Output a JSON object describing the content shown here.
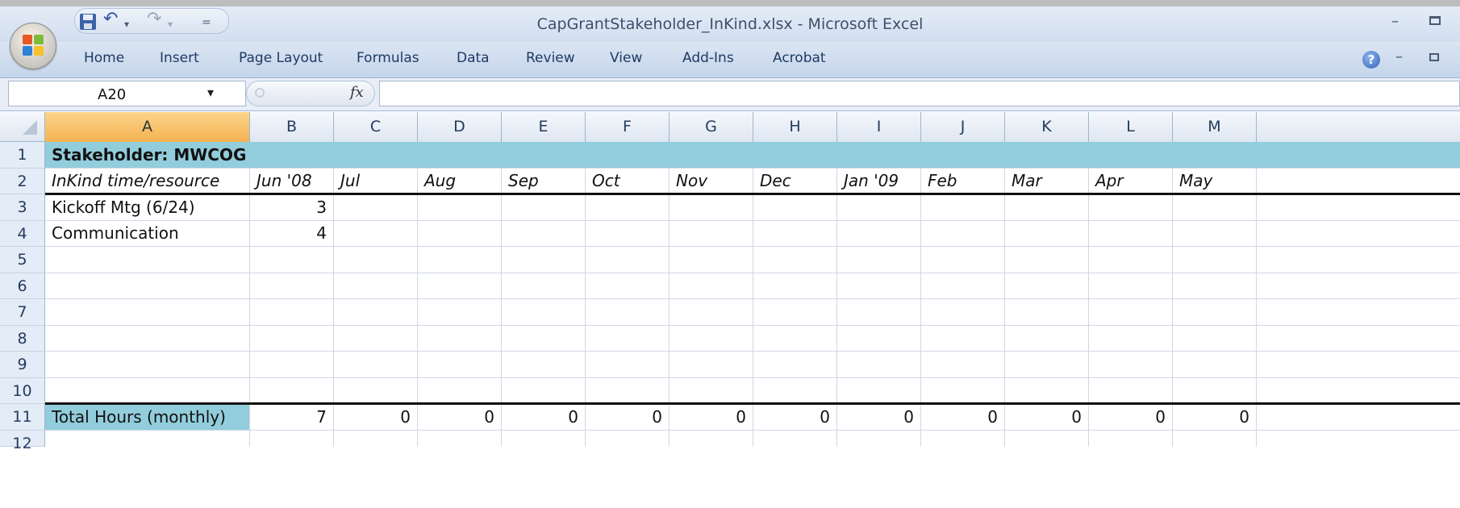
{
  "window": {
    "title": "CapGrantStakeholder_InKind.xlsx - Microsoft Excel",
    "minimize_glyph": "–"
  },
  "qat": {
    "save_icon": "save-icon",
    "undo_glyph": "↶",
    "redo_glyph": "↷",
    "dropdown_glyph": "▾",
    "customize_glyph": "="
  },
  "ribbon": {
    "tabs": [
      "Home",
      "Insert",
      "Page Layout",
      "Formulas",
      "Data",
      "Review",
      "View",
      "Add-Ins",
      "Acrobat"
    ],
    "help_glyph": "?",
    "minimize_glyph": "–"
  },
  "formula_bar": {
    "name_box": "A20",
    "name_box_dropdown": "▾",
    "fx_label": "fx",
    "formula": ""
  },
  "sheet": {
    "columns": [
      "A",
      "B",
      "C",
      "D",
      "E",
      "F",
      "G",
      "H",
      "I",
      "J",
      "K",
      "L",
      "M"
    ],
    "selected_column": "A",
    "row_numbers": [
      "1",
      "2",
      "3",
      "4",
      "5",
      "6",
      "7",
      "8",
      "9",
      "10",
      "11",
      "12"
    ],
    "title": "Stakeholder:  MWCOG",
    "header_row": [
      "InKind time/resource",
      "Jun '08",
      "Jul",
      "Aug",
      "Sep",
      "Oct",
      "Nov",
      "Dec",
      "Jan '09",
      "Feb",
      "Mar",
      "Apr",
      "May"
    ],
    "data_rows": [
      [
        "Kickoff Mtg (6/24)",
        "3",
        "",
        "",
        "",
        "",
        "",
        "",
        "",
        "",
        "",
        "",
        ""
      ],
      [
        "Communication",
        "4",
        "",
        "",
        "",
        "",
        "",
        "",
        "",
        "",
        "",
        "",
        ""
      ],
      [
        "",
        "",
        "",
        "",
        "",
        "",
        "",
        "",
        "",
        "",
        "",
        "",
        ""
      ],
      [
        "",
        "",
        "",
        "",
        "",
        "",
        "",
        "",
        "",
        "",
        "",
        "",
        ""
      ],
      [
        "",
        "",
        "",
        "",
        "",
        "",
        "",
        "",
        "",
        "",
        "",
        "",
        ""
      ],
      [
        "",
        "",
        "",
        "",
        "",
        "",
        "",
        "",
        "",
        "",
        "",
        "",
        ""
      ],
      [
        "",
        "",
        "",
        "",
        "",
        "",
        "",
        "",
        "",
        "",
        "",
        "",
        ""
      ],
      [
        "",
        "",
        "",
        "",
        "",
        "",
        "",
        "",
        "",
        "",
        "",
        "",
        ""
      ]
    ],
    "total_row": [
      "Total Hours (monthly)",
      "7",
      "0",
      "0",
      "0",
      "0",
      "0",
      "0",
      "0",
      "0",
      "0",
      "0",
      "0"
    ]
  },
  "colors": {
    "banner": "#92cddc",
    "selected_column_header": "#f5b24f",
    "ribbon": "#c5d5ea"
  }
}
